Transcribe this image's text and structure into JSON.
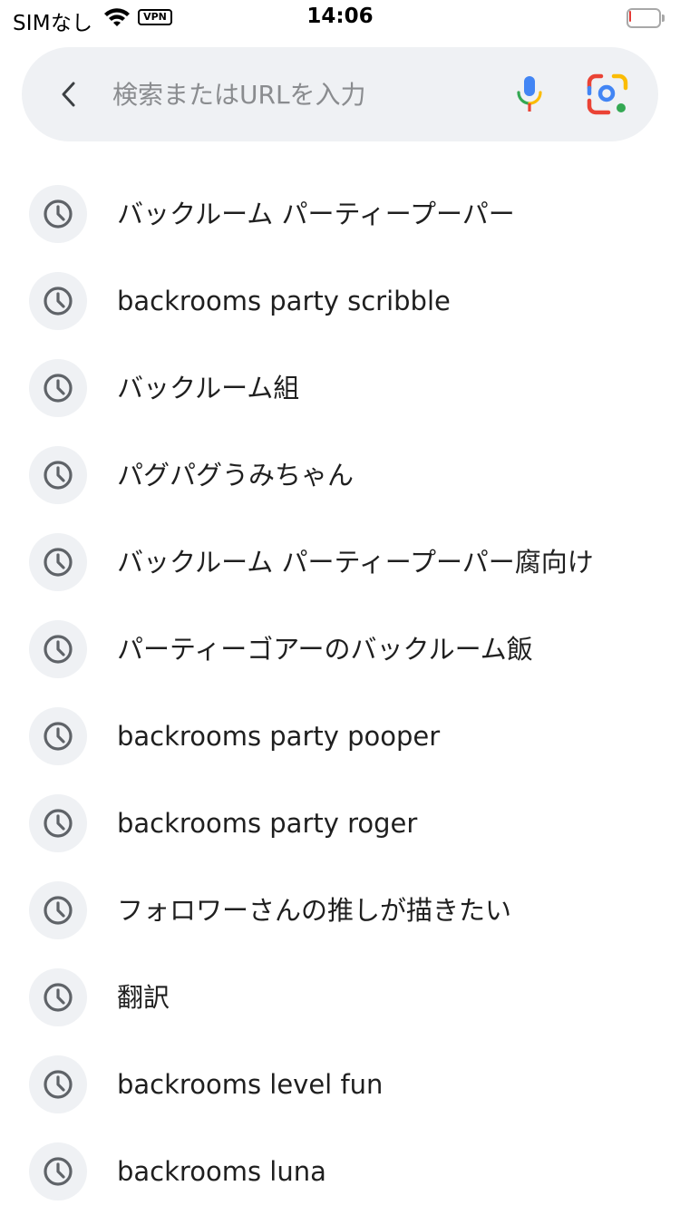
{
  "status_bar": {
    "carrier": "SIMなし",
    "vpn_label": "VPN",
    "time": "14:06",
    "battery_level": 0.08,
    "battery_color": "#e53935"
  },
  "search": {
    "placeholder": "検索またはURLを入力",
    "value": "",
    "back_icon": "chevron-left-icon",
    "mic_icon": "microphone-icon",
    "lens_icon": "google-lens-icon"
  },
  "history": {
    "icon": "history-clock-icon",
    "items": [
      {
        "label": "バックルーム パーティープーパー"
      },
      {
        "label": "backrooms party scribble"
      },
      {
        "label": "バックルーム組"
      },
      {
        "label": "パグパグうみちゃん"
      },
      {
        "label": "バックルーム パーティープーパー腐向け"
      },
      {
        "label": "パーティーゴアーのバックルーム飯"
      },
      {
        "label": "backrooms party pooper"
      },
      {
        "label": "backrooms party roger"
      },
      {
        "label": "フォロワーさんの推しが描きたい"
      },
      {
        "label": "翻訳"
      },
      {
        "label": "backrooms level fun"
      },
      {
        "label": "backrooms luna"
      }
    ]
  },
  "colors": {
    "search_bg": "#eff1f4",
    "google_blue": "#4285f4",
    "google_red": "#ea4335",
    "google_yellow": "#fbbc04",
    "google_green": "#34a853"
  }
}
